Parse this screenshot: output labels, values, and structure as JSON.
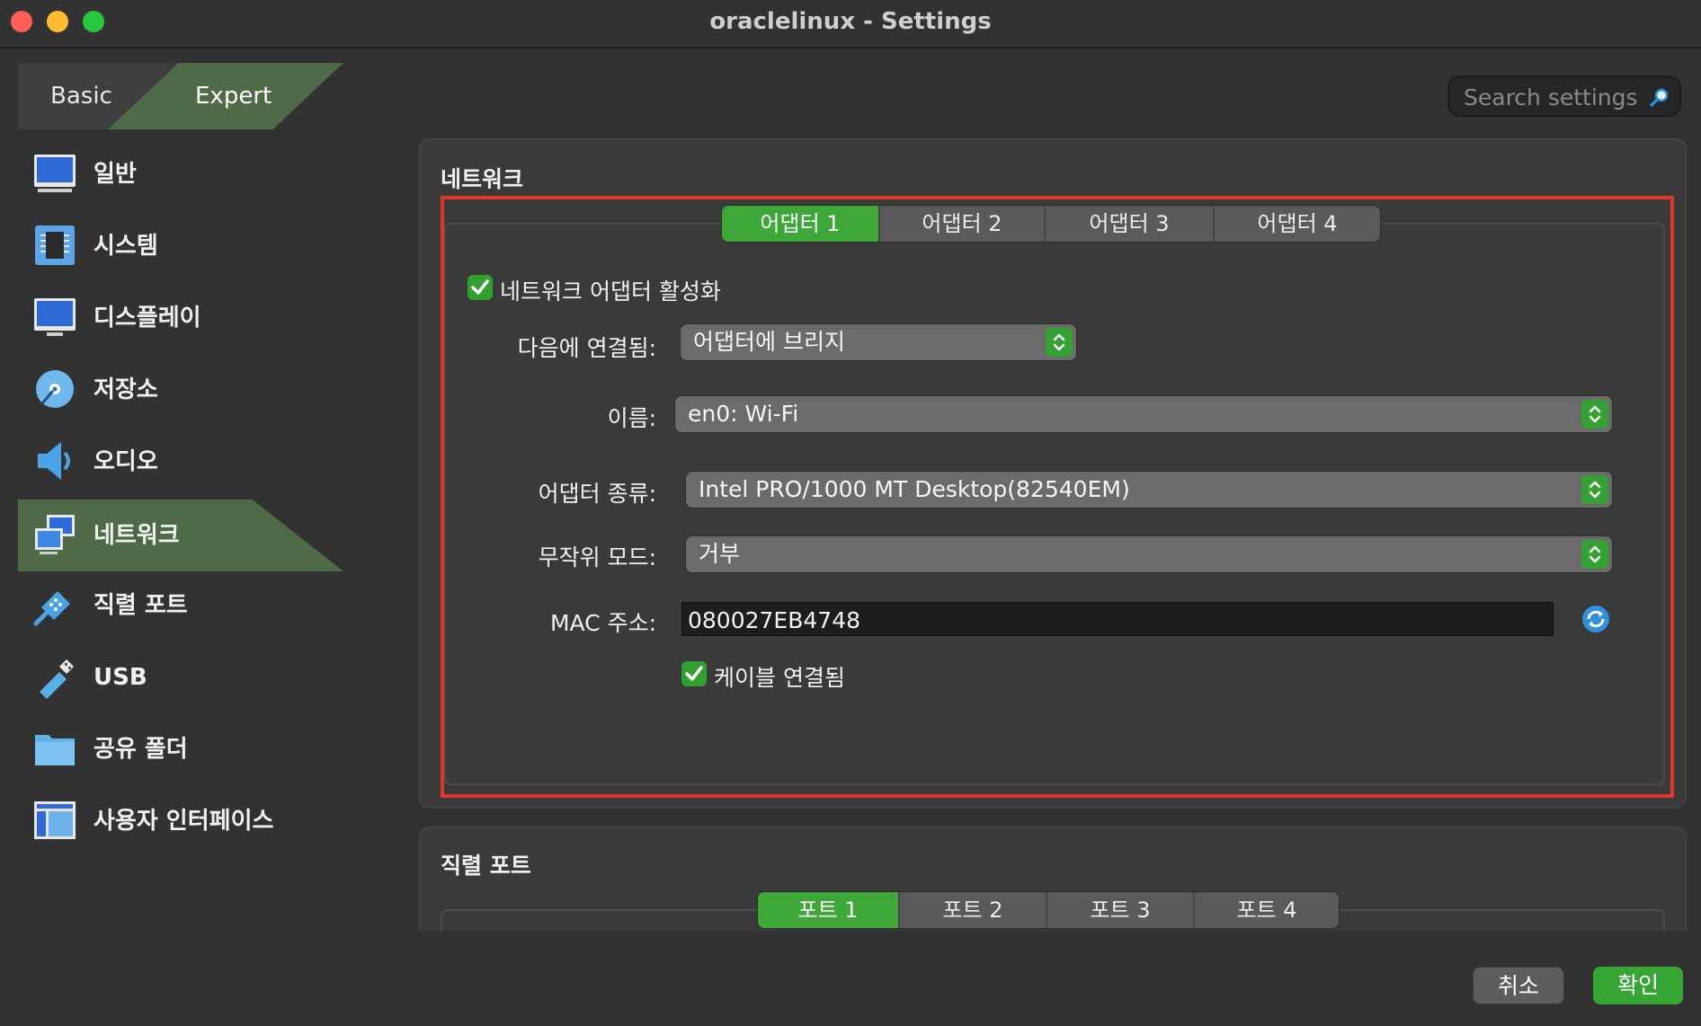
{
  "window": {
    "title": "oraclelinux - Settings"
  },
  "mode_tabs": {
    "basic": "Basic",
    "expert": "Expert",
    "active": "Expert"
  },
  "search": {
    "placeholder": "Search settings"
  },
  "sidebar": {
    "items": [
      {
        "label": "일반",
        "icon": "monitor-icon"
      },
      {
        "label": "시스템",
        "icon": "chip-icon"
      },
      {
        "label": "디스플레이",
        "icon": "display-icon"
      },
      {
        "label": "저장소",
        "icon": "disk-icon"
      },
      {
        "label": "오디오",
        "icon": "speaker-icon"
      },
      {
        "label": "네트워크",
        "icon": "network-icon",
        "active": true
      },
      {
        "label": "직렬 포트",
        "icon": "serial-port-icon"
      },
      {
        "label": "USB",
        "icon": "usb-icon"
      },
      {
        "label": "공유 폴더",
        "icon": "folder-icon"
      },
      {
        "label": "사용자 인터페이스",
        "icon": "ui-window-icon"
      }
    ]
  },
  "network": {
    "title": "네트워크",
    "tabs": [
      "어댑터 1",
      "어댑터 2",
      "어댑터 3",
      "어댑터 4"
    ],
    "active_tab": "어댑터 1",
    "enable_label": "네트워크 어댑터 활성화",
    "enable_checked": true,
    "attached_label": "다음에 연결됨:",
    "attached_value": "어댑터에 브리지",
    "name_label": "이름:",
    "name_value": "en0: Wi-Fi",
    "type_label": "어댑터 종류:",
    "type_value": "Intel PRO/1000 MT Desktop(82540EM)",
    "promisc_label": "무작위 모드:",
    "promisc_value": "거부",
    "mac_label": "MAC 주소:",
    "mac_value": "080027EB4748",
    "cable_label": "케이블 연결됨",
    "cable_checked": true
  },
  "serial": {
    "title": "직렬 포트",
    "tabs": [
      "포트 1",
      "포트 2",
      "포트 3",
      "포트 4"
    ],
    "active_tab": "포트 1"
  },
  "footer": {
    "cancel": "취소",
    "ok": "확인"
  },
  "colors": {
    "accent_green": "#3da838",
    "highlight_red": "#e0362b",
    "active_sidebar": "#4f6a47"
  }
}
